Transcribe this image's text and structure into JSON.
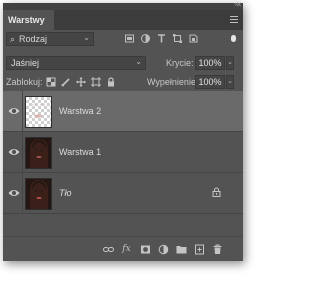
{
  "panel": {
    "tab_title": "Warstwy"
  },
  "filter": {
    "kind_label": "Rodzaj",
    "icons": [
      "image-filter-icon",
      "adjustment-filter-icon",
      "type-filter-icon",
      "shape-filter-icon",
      "smart-object-filter-icon"
    ]
  },
  "blend": {
    "mode": "Jaśniej",
    "opacity_label": "Krycie:",
    "opacity_value": "100%"
  },
  "lock": {
    "label": "Zablokuj:",
    "fill_label": "Wypełnienie:",
    "fill_value": "100%"
  },
  "layers": [
    {
      "name": "Warstwa 2",
      "selected": true,
      "thumb": "transparent",
      "locked": false
    },
    {
      "name": "Warstwa 1",
      "selected": false,
      "thumb": "portrait",
      "locked": false
    },
    {
      "name": "Tło",
      "selected": false,
      "thumb": "portrait",
      "locked": true
    }
  ],
  "bottom_icons": [
    "link-icon",
    "fx-icon",
    "mask-icon",
    "adjustment-icon",
    "folder-icon",
    "new-layer-icon",
    "trash-icon"
  ],
  "bottom_fx_label": "fx",
  "colors": {
    "panel_bg": "#535353",
    "selected_row": "#6a6a6a",
    "tabbar_bg": "#3c3c3c"
  }
}
